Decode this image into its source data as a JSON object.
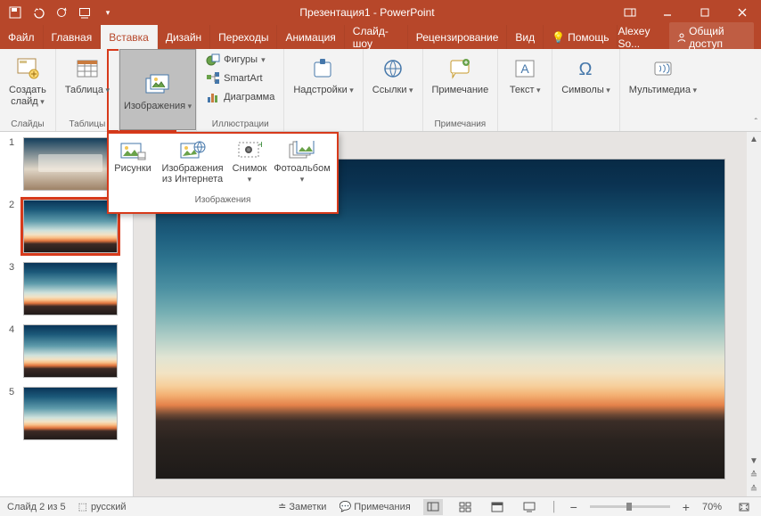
{
  "app": {
    "title": "Презентация1 - PowerPoint",
    "user": "Alexey So..."
  },
  "tabs": [
    {
      "label": "Файл"
    },
    {
      "label": "Главная"
    },
    {
      "label": "Вставка",
      "active": true
    },
    {
      "label": "Дизайн"
    },
    {
      "label": "Переходы"
    },
    {
      "label": "Анимация"
    },
    {
      "label": "Слайд-шоу"
    },
    {
      "label": "Рецензирование"
    },
    {
      "label": "Вид"
    },
    {
      "label": "Помощь"
    }
  ],
  "share": "Общий доступ",
  "ribbon": {
    "groups": {
      "slides": {
        "label": "Слайды",
        "newSlide": "Создать\nслайд"
      },
      "tables": {
        "label": "Таблицы",
        "btn": "Таблица"
      },
      "images": {
        "label": "",
        "btn": "Изображения"
      },
      "illustrations": {
        "label": "Иллюстрации",
        "shapes": "Фигуры",
        "smartart": "SmartArt",
        "chart": "Диаграмма"
      },
      "addins": {
        "label": "",
        "btn": "Надстройки"
      },
      "links": {
        "label": "",
        "btn": "Ссылки"
      },
      "comments": {
        "label": "Примечания",
        "btn": "Примечание"
      },
      "text": {
        "label": "",
        "btn": "Текст"
      },
      "symbols": {
        "label": "",
        "btn": "Символы"
      },
      "media": {
        "label": "",
        "btn": "Мультимедиа"
      }
    }
  },
  "gallery": {
    "label": "Изображения",
    "items": [
      {
        "label": "Рисунки"
      },
      {
        "label": "Изображения\nиз Интернета"
      },
      {
        "label": "Снимок"
      },
      {
        "label": "Фотоальбом"
      }
    ]
  },
  "thumbs": [
    1,
    2,
    3,
    4,
    5
  ],
  "selectedSlide": 2,
  "status": {
    "slideOf": "Слайд 2 из 5",
    "lang": "русский",
    "notes": "Заметки",
    "comments": "Примечания",
    "zoom": "70%"
  }
}
